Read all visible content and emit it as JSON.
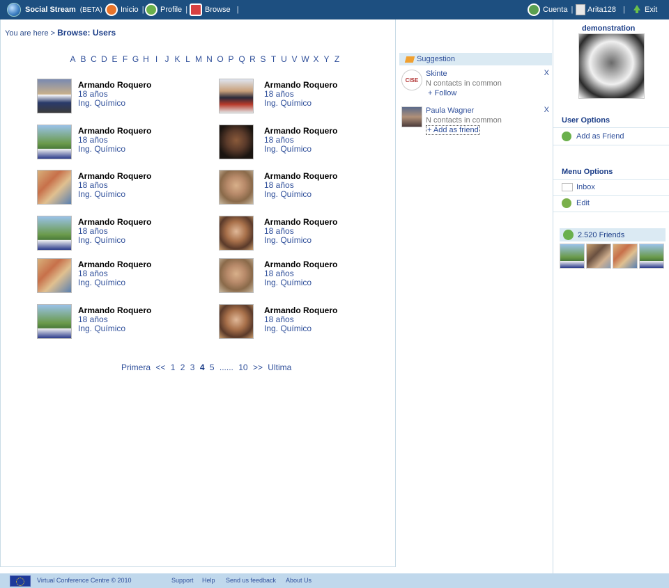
{
  "topbar": {
    "app_name": "Social Stream",
    "beta": "(BETA)",
    "nav_inicio": "Inicio",
    "nav_profile": "Profile",
    "nav_browse": "Browse",
    "sep": "|",
    "cuenta": "Cuenta",
    "username": "Arita128",
    "exit": "Exit"
  },
  "breadcrumb": {
    "prefix": "You are here >",
    "current": "Browse: Users"
  },
  "alphabet": [
    "A",
    "B",
    "C",
    "D",
    "E",
    "F",
    "G",
    "H",
    "I",
    "J",
    "K",
    "L",
    "M",
    "N",
    "O",
    "P",
    "Q",
    "R",
    "S",
    "T",
    "U",
    "V",
    "W",
    "X",
    "Y",
    "Z"
  ],
  "users": [
    {
      "name": "Armando Roquero",
      "age": "18 años",
      "profession": "Ing. Químico"
    },
    {
      "name": "Armando Roquero",
      "age": "18 años",
      "profession": "Ing. Químico"
    },
    {
      "name": "Armando Roquero",
      "age": "18 años",
      "profession": "Ing. Químico"
    },
    {
      "name": "Armando Roquero",
      "age": "18 años",
      "profession": "Ing. Químico"
    },
    {
      "name": "Armando Roquero",
      "age": "18 años",
      "profession": "Ing. Químico"
    },
    {
      "name": "Armando Roquero",
      "age": "18 años",
      "profession": "Ing. Químico"
    },
    {
      "name": "Armando Roquero",
      "age": "18 años",
      "profession": "Ing. Químico"
    },
    {
      "name": "Armando Roquero",
      "age": "18 años",
      "profession": "Ing. Químico"
    },
    {
      "name": "Armando Roquero",
      "age": "18 años",
      "profession": "Ing. Químico"
    },
    {
      "name": "Armando Roquero",
      "age": "18 años",
      "profession": "Ing. Químico"
    },
    {
      "name": "Armando Roquero",
      "age": "18 años",
      "profession": "Ing. Químico"
    },
    {
      "name": "Armando Roquero",
      "age": "18 años",
      "profession": "Ing. Químico"
    }
  ],
  "pagination": {
    "first": "Primera",
    "prev": "<<",
    "pages": [
      "1",
      "2",
      "3"
    ],
    "current": "4",
    "next_page": "5",
    "ellipsis": "......",
    "last_page": "10",
    "next": ">>",
    "last": "Ultima"
  },
  "suggestion": {
    "title": "Suggestion",
    "items": [
      {
        "name": "Skinte",
        "common": "N contacts in common",
        "action": "+ Follow",
        "close": "X",
        "logo_text": "CISE"
      },
      {
        "name": "Paula Wagner",
        "common": "N contacts in common",
        "action": "+ Add as friend",
        "close": "X"
      }
    ]
  },
  "profile": {
    "name": "demonstration",
    "user_options_title": "User Options",
    "add_friend": "Add as Friend",
    "menu_options_title": "Menu Options",
    "inbox": "Inbox",
    "edit": "Edit",
    "friends_count": "2.520 Friends"
  },
  "footer": {
    "org": "Virtual Conference Centre © 2010",
    "support": "Support",
    "help": "Help",
    "feedback": "Send us feedback",
    "about": "About Us"
  },
  "colors": {
    "topbar": "#1d4f80",
    "link": "#2f4f9a",
    "heading": "#1c3e88",
    "panel_head": "#dbeaf3",
    "footer": "#c0d8ec"
  }
}
